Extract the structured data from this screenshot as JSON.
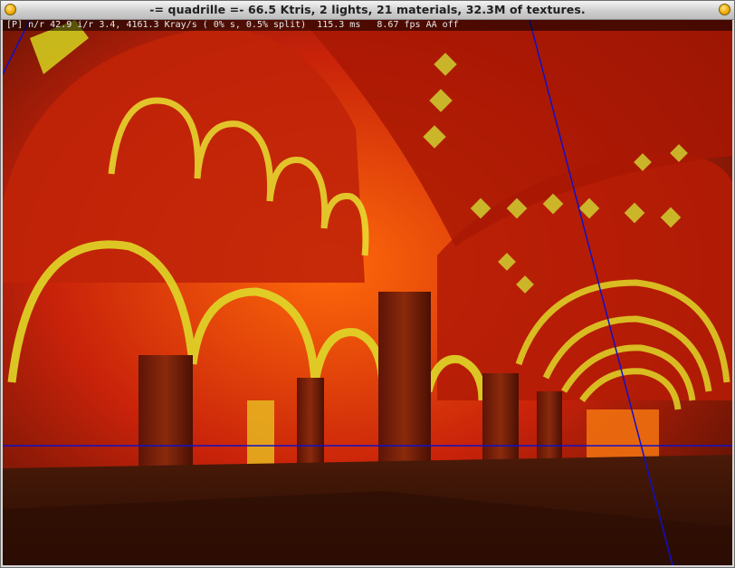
{
  "window": {
    "title": "-= quadrille =-  66.5 Ktris, 2 lights, 21 materials, 32.3M of textures."
  },
  "hud": {
    "stats": "[P] n/r 42.9 i/r 3.4, 4161.3 Kray/s ( 0% s, 0.5% split)  115.3 ms   8.67 fps AA off"
  },
  "colors": {
    "background": "#2b0f05",
    "stone_red": "#b81a04",
    "stone_orange": "#e8540a",
    "highlight_yellow": "#e0e020",
    "guide_line": "#1010c8"
  },
  "icons": {
    "left_button": "window-menu-icon",
    "right_button": "window-close-icon"
  }
}
